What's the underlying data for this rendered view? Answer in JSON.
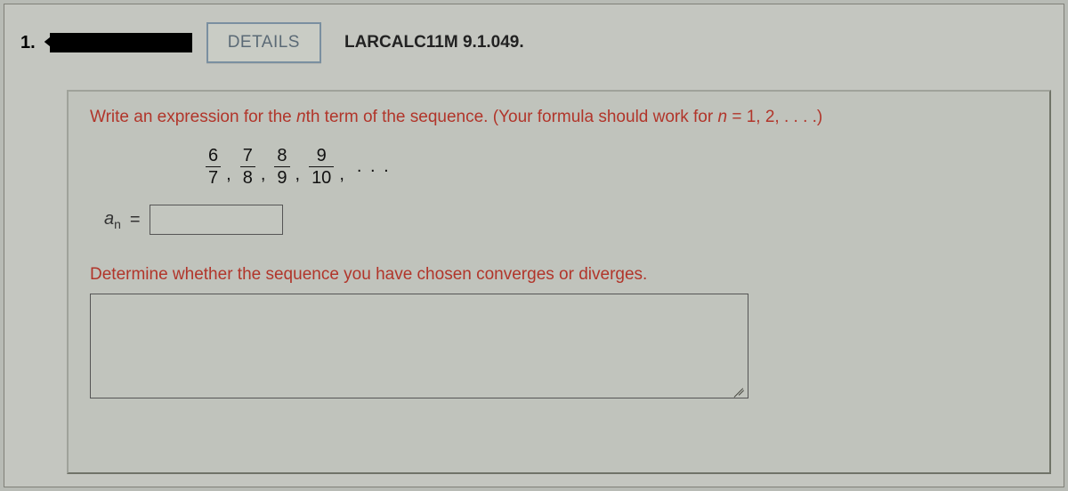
{
  "header": {
    "question_number": "1.",
    "details_label": "DETAILS",
    "problem_code": "LARCALC11M 9.1.049."
  },
  "content": {
    "prompt_nth_term_prefix": "Write an expression for the ",
    "prompt_nth_term_n": "n",
    "prompt_nth_term_mid": "th term of the sequence. (Your formula should work for ",
    "prompt_nth_term_nvar": "n",
    "prompt_nth_term_suffix": " = 1, 2, . . . .)",
    "sequence": {
      "terms": [
        {
          "num": "6",
          "den": "7"
        },
        {
          "num": "7",
          "den": "8"
        },
        {
          "num": "8",
          "den": "9"
        },
        {
          "num": "9",
          "den": "10"
        }
      ],
      "comma": ",",
      "ellipsis": ". . ."
    },
    "answer_label_a": "a",
    "answer_label_sub": "n",
    "equals": "=",
    "answer_value": "",
    "prompt_converge": "Determine whether the sequence you have chosen converges or diverges.",
    "essay_value": ""
  }
}
